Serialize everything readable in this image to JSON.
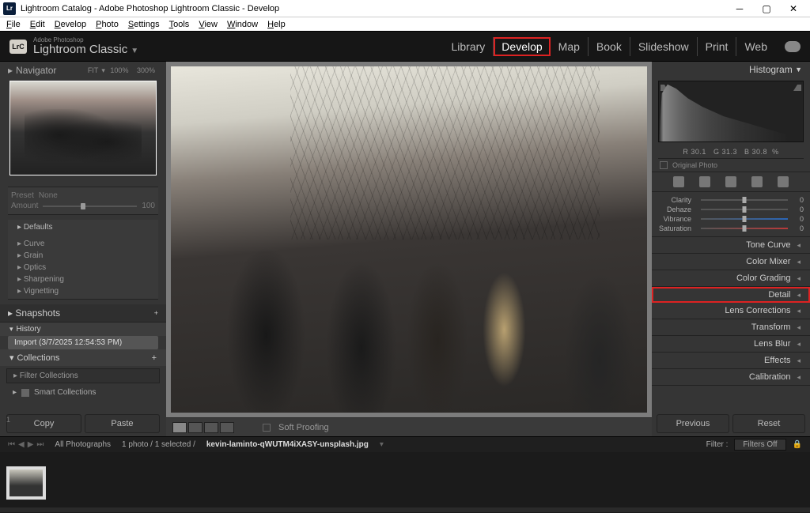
{
  "window": {
    "title": "Lightroom Catalog - Adobe Photoshop Lightroom Classic - Develop"
  },
  "menu": [
    "File",
    "Edit",
    "Develop",
    "Photo",
    "Settings",
    "Tools",
    "View",
    "Window",
    "Help"
  ],
  "brand": {
    "badge": "LrC",
    "adobe": "Adobe Photoshop",
    "product": "Lightroom Classic"
  },
  "modules": {
    "items": [
      "Library",
      "Develop",
      "Map",
      "Book",
      "Slideshow",
      "Print",
      "Web"
    ],
    "active": "Develop"
  },
  "navigator": {
    "title": "Navigator",
    "zoom": {
      "mode": "FIT",
      "lvl1": "100%",
      "lvl2": "300%"
    }
  },
  "preset_meta": {
    "preset_label": "Preset",
    "preset_value": "None",
    "amount_label": "Amount",
    "amount_value": "100"
  },
  "preset_list": {
    "defaults": "Defaults",
    "items": [
      "Curve",
      "Grain",
      "Optics",
      "Sharpening",
      "Vignetting"
    ]
  },
  "snapshots": {
    "title": "Snapshots"
  },
  "history": {
    "title": "History",
    "entry": "Import (3/7/2025 12:54:53 PM)"
  },
  "collections": {
    "title": "Collections",
    "filter_placeholder": "Filter Collections",
    "smart": "Smart Collections"
  },
  "left_buttons": {
    "copy": "Copy",
    "paste": "Paste"
  },
  "center_toolbar": {
    "soft_proof": "Soft Proofing"
  },
  "histogram": {
    "title": "Histogram",
    "readout": {
      "r_label": "R",
      "r": "30.1",
      "g_label": "G",
      "g": "31.3",
      "b_label": "B",
      "b": "30.8",
      "pct": "%"
    },
    "original": "Original Photo"
  },
  "adjustments": [
    {
      "label": "Clarity",
      "value": "0",
      "cls": ""
    },
    {
      "label": "Dehaze",
      "value": "0",
      "cls": ""
    },
    {
      "label": "Vibrance",
      "value": "0",
      "cls": "vib"
    },
    {
      "label": "Saturation",
      "value": "0",
      "cls": "sat"
    }
  ],
  "right_sections": [
    "Tone Curve",
    "Color Mixer",
    "Color Grading",
    "Detail",
    "Lens Corrections",
    "Transform",
    "Lens Blur",
    "Effects",
    "Calibration"
  ],
  "right_highlight": "Detail",
  "right_buttons": {
    "previous": "Previous",
    "reset": "Reset"
  },
  "crumb": {
    "folder": "All Photographs",
    "count": "1 photo / 1 selected /",
    "filename": "kevin-laminto-qWUTM4iXASY-unsplash.jpg",
    "filter_label": "Filter :",
    "filter_value": "Filters Off"
  },
  "filmstrip": {
    "index": "1"
  }
}
